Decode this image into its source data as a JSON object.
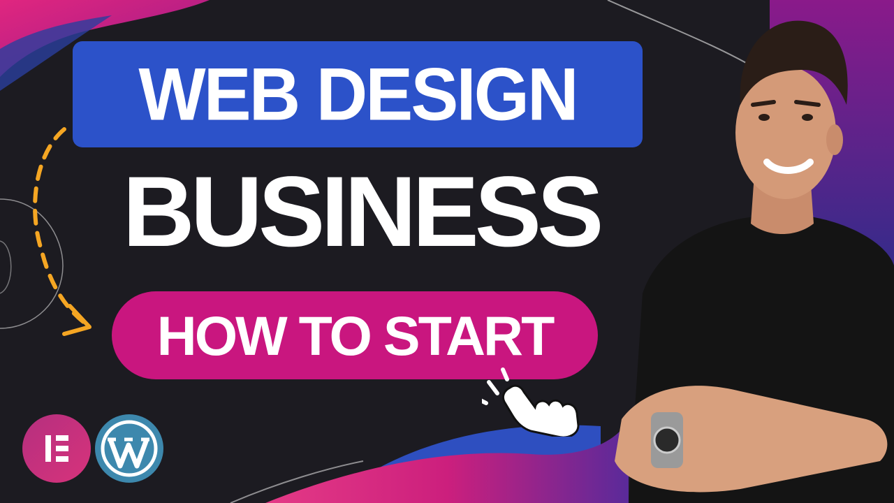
{
  "thumbnail": {
    "headline_top": "WEB DESIGN",
    "headline_main": "BUSINESS",
    "cta_label": "HOW TO START"
  },
  "logos": [
    {
      "name": "elementor-logo",
      "icon": "elementor-e-icon"
    },
    {
      "name": "wordpress-logo",
      "icon": "wordpress-w-icon"
    }
  ],
  "colors": {
    "background": "#1c1b21",
    "title_box": "#2c52c9",
    "cta_pill": "#c9167f",
    "accent_magenta": "#d6237f",
    "accent_blue": "#2e4fc0",
    "arrow_orange": "#f5a623"
  }
}
